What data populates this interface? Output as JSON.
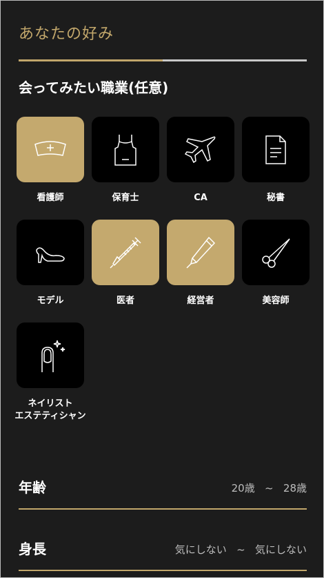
{
  "header": {
    "title": "あなたの好み",
    "progress": 0.5
  },
  "section": {
    "title": "会ってみたい職業(任意)"
  },
  "colors": {
    "accent": "#c2a76b",
    "tile_selected": "#c4a96e",
    "tile": "#000000",
    "background": "#1c1c1c"
  },
  "jobs": [
    {
      "label": "看護師",
      "icon": "nurse-cap-icon",
      "selected": true
    },
    {
      "label": "保育士",
      "icon": "apron-icon",
      "selected": false
    },
    {
      "label": "CA",
      "icon": "airplane-icon",
      "selected": false
    },
    {
      "label": "秘書",
      "icon": "document-icon",
      "selected": false
    },
    {
      "label": "モデル",
      "icon": "high-heel-icon",
      "selected": false
    },
    {
      "label": "医者",
      "icon": "syringe-icon",
      "selected": true
    },
    {
      "label": "経営者",
      "icon": "pen-icon",
      "selected": true
    },
    {
      "label": "美容師",
      "icon": "scissors-icon",
      "selected": false
    },
    {
      "label": "ネイリスト\nエステティシャン",
      "icon": "nail-icon",
      "selected": false
    }
  ],
  "preferences": {
    "age": {
      "label": "年齢",
      "min": "20歳",
      "separator": "~",
      "max": "28歳"
    },
    "height": {
      "label": "身長",
      "min": "気にしない",
      "separator": "~",
      "max": "気にしない"
    }
  }
}
